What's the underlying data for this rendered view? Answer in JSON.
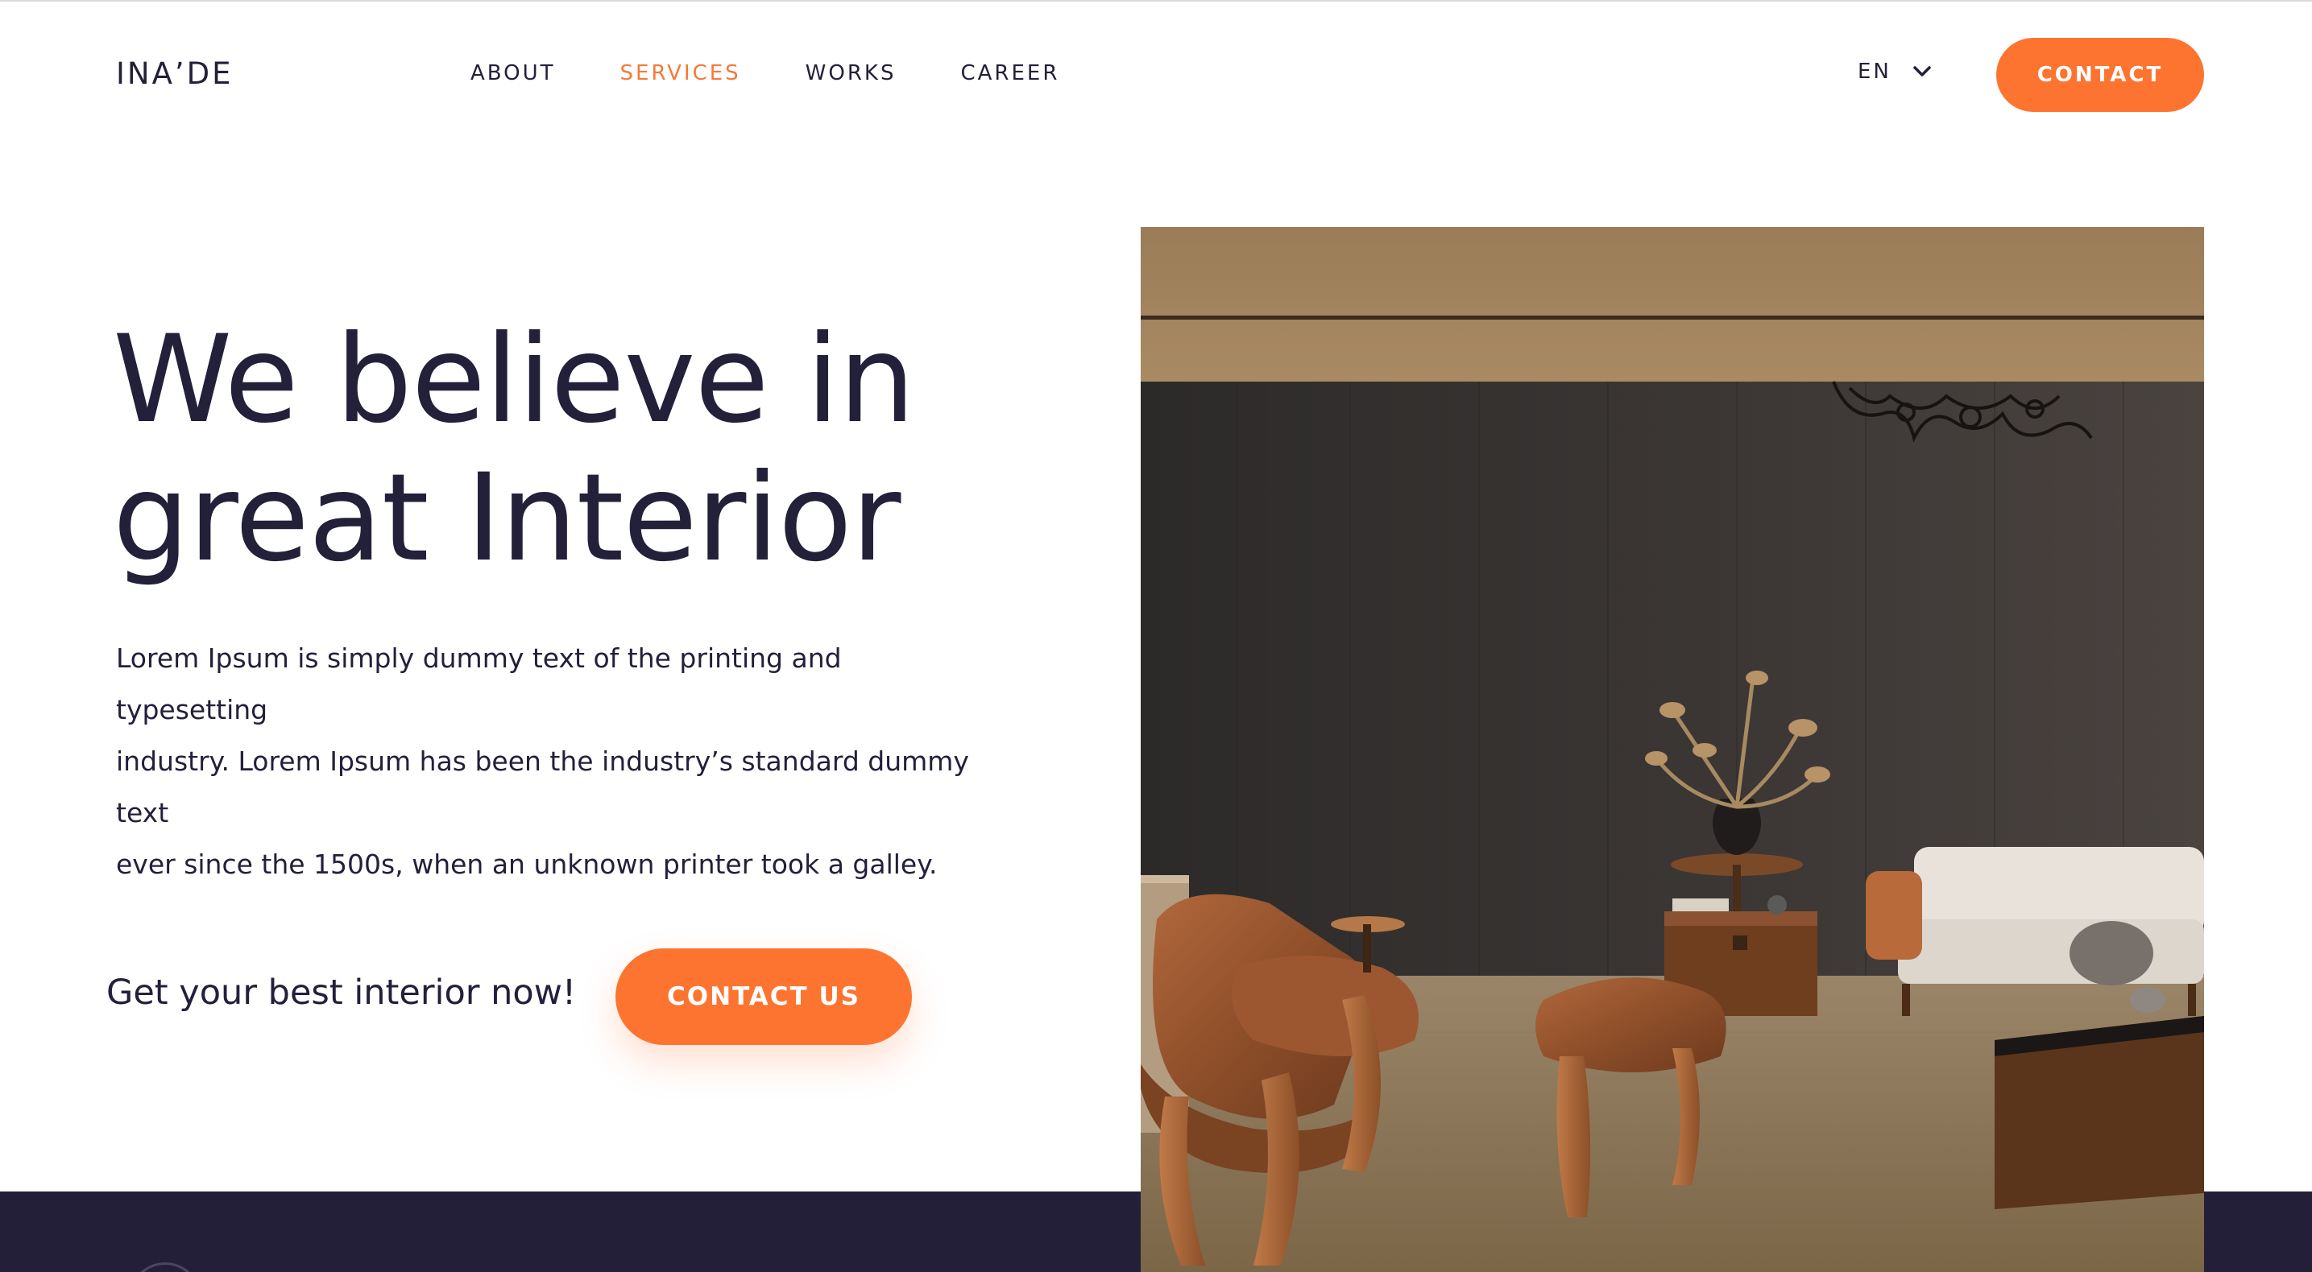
{
  "brand": {
    "logo": "INA’DE",
    "accent": "#fd7431",
    "dark": "#231f38"
  },
  "nav": {
    "items": [
      {
        "label": "ABOUT",
        "active": false
      },
      {
        "label": "SERVICES",
        "active": true
      },
      {
        "label": "WORKS",
        "active": false
      },
      {
        "label": "CAREER",
        "active": false
      }
    ],
    "language": "EN",
    "language_icon": "chevron-down-icon",
    "contact_label": "CONTACT"
  },
  "hero": {
    "title_line1": "We believe in",
    "title_line2": "great Interior",
    "body_line1": "Lorem Ipsum is simply dummy text of the printing and typesetting",
    "body_line2": "industry. Lorem Ipsum has been the industry’s standard dummy text",
    "body_line3": "ever since the 1500s, when an unknown printer took a galley.",
    "cta_text": "Get your best interior now!",
    "cta_button": "CONTACT US"
  }
}
